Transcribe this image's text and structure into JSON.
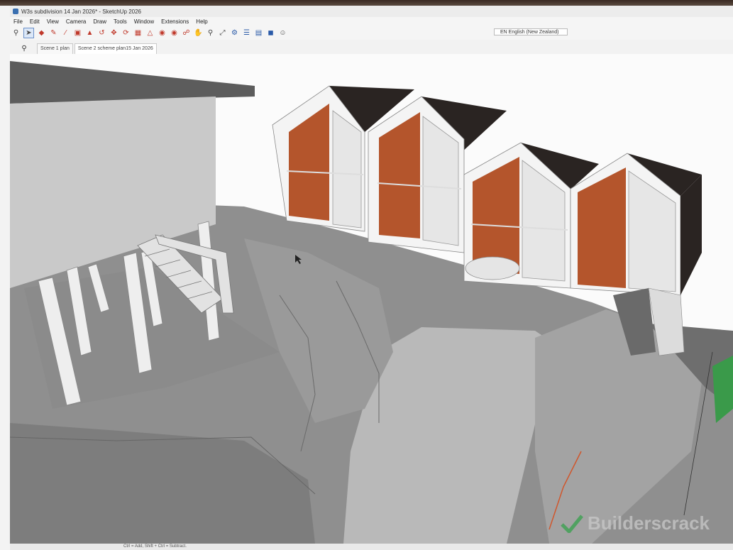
{
  "window": {
    "title": "W3s subdivision 14 Jan 2026* - SketchUp 2026"
  },
  "menu": [
    "File",
    "Edit",
    "View",
    "Camera",
    "Draw",
    "Tools",
    "Window",
    "Extensions",
    "Help"
  ],
  "toolbar": {
    "language": "EN English (New Zealand)"
  },
  "scenes": {
    "tabs": [
      "Scene 1 plan",
      "Scene 2 scheme plan15 Jan 2026"
    ]
  },
  "status": {
    "hint": "Ctrl = Add, Shift + Ctrl = Subtract."
  },
  "watermark": {
    "text": "Builderscrack"
  },
  "colors": {
    "cladding": "#b4552c",
    "roof": "#2a2422",
    "terrain": "#8c8c8c",
    "accent_green": "#3a9a4a"
  }
}
